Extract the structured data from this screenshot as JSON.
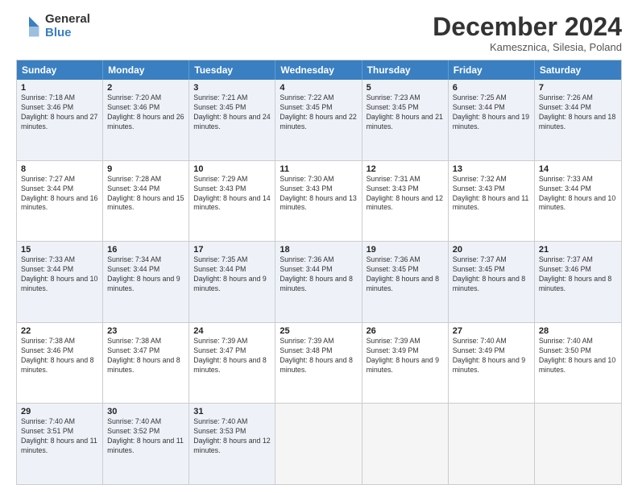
{
  "logo": {
    "general": "General",
    "blue": "Blue"
  },
  "header": {
    "month": "December 2024",
    "location": "Kamesznica, Silesia, Poland"
  },
  "days": [
    "Sunday",
    "Monday",
    "Tuesday",
    "Wednesday",
    "Thursday",
    "Friday",
    "Saturday"
  ],
  "rows": [
    [
      {
        "day": "1",
        "rise": "Sunrise: 7:18 AM",
        "set": "Sunset: 3:46 PM",
        "light": "Daylight: 8 hours and 27 minutes."
      },
      {
        "day": "2",
        "rise": "Sunrise: 7:20 AM",
        "set": "Sunset: 3:46 PM",
        "light": "Daylight: 8 hours and 26 minutes."
      },
      {
        "day": "3",
        "rise": "Sunrise: 7:21 AM",
        "set": "Sunset: 3:45 PM",
        "light": "Daylight: 8 hours and 24 minutes."
      },
      {
        "day": "4",
        "rise": "Sunrise: 7:22 AM",
        "set": "Sunset: 3:45 PM",
        "light": "Daylight: 8 hours and 22 minutes."
      },
      {
        "day": "5",
        "rise": "Sunrise: 7:23 AM",
        "set": "Sunset: 3:45 PM",
        "light": "Daylight: 8 hours and 21 minutes."
      },
      {
        "day": "6",
        "rise": "Sunrise: 7:25 AM",
        "set": "Sunset: 3:44 PM",
        "light": "Daylight: 8 hours and 19 minutes."
      },
      {
        "day": "7",
        "rise": "Sunrise: 7:26 AM",
        "set": "Sunset: 3:44 PM",
        "light": "Daylight: 8 hours and 18 minutes."
      }
    ],
    [
      {
        "day": "8",
        "rise": "Sunrise: 7:27 AM",
        "set": "Sunset: 3:44 PM",
        "light": "Daylight: 8 hours and 16 minutes."
      },
      {
        "day": "9",
        "rise": "Sunrise: 7:28 AM",
        "set": "Sunset: 3:44 PM",
        "light": "Daylight: 8 hours and 15 minutes."
      },
      {
        "day": "10",
        "rise": "Sunrise: 7:29 AM",
        "set": "Sunset: 3:43 PM",
        "light": "Daylight: 8 hours and 14 minutes."
      },
      {
        "day": "11",
        "rise": "Sunrise: 7:30 AM",
        "set": "Sunset: 3:43 PM",
        "light": "Daylight: 8 hours and 13 minutes."
      },
      {
        "day": "12",
        "rise": "Sunrise: 7:31 AM",
        "set": "Sunset: 3:43 PM",
        "light": "Daylight: 8 hours and 12 minutes."
      },
      {
        "day": "13",
        "rise": "Sunrise: 7:32 AM",
        "set": "Sunset: 3:43 PM",
        "light": "Daylight: 8 hours and 11 minutes."
      },
      {
        "day": "14",
        "rise": "Sunrise: 7:33 AM",
        "set": "Sunset: 3:44 PM",
        "light": "Daylight: 8 hours and 10 minutes."
      }
    ],
    [
      {
        "day": "15",
        "rise": "Sunrise: 7:33 AM",
        "set": "Sunset: 3:44 PM",
        "light": "Daylight: 8 hours and 10 minutes."
      },
      {
        "day": "16",
        "rise": "Sunrise: 7:34 AM",
        "set": "Sunset: 3:44 PM",
        "light": "Daylight: 8 hours and 9 minutes."
      },
      {
        "day": "17",
        "rise": "Sunrise: 7:35 AM",
        "set": "Sunset: 3:44 PM",
        "light": "Daylight: 8 hours and 9 minutes."
      },
      {
        "day": "18",
        "rise": "Sunrise: 7:36 AM",
        "set": "Sunset: 3:44 PM",
        "light": "Daylight: 8 hours and 8 minutes."
      },
      {
        "day": "19",
        "rise": "Sunrise: 7:36 AM",
        "set": "Sunset: 3:45 PM",
        "light": "Daylight: 8 hours and 8 minutes."
      },
      {
        "day": "20",
        "rise": "Sunrise: 7:37 AM",
        "set": "Sunset: 3:45 PM",
        "light": "Daylight: 8 hours and 8 minutes."
      },
      {
        "day": "21",
        "rise": "Sunrise: 7:37 AM",
        "set": "Sunset: 3:46 PM",
        "light": "Daylight: 8 hours and 8 minutes."
      }
    ],
    [
      {
        "day": "22",
        "rise": "Sunrise: 7:38 AM",
        "set": "Sunset: 3:46 PM",
        "light": "Daylight: 8 hours and 8 minutes."
      },
      {
        "day": "23",
        "rise": "Sunrise: 7:38 AM",
        "set": "Sunset: 3:47 PM",
        "light": "Daylight: 8 hours and 8 minutes."
      },
      {
        "day": "24",
        "rise": "Sunrise: 7:39 AM",
        "set": "Sunset: 3:47 PM",
        "light": "Daylight: 8 hours and 8 minutes."
      },
      {
        "day": "25",
        "rise": "Sunrise: 7:39 AM",
        "set": "Sunset: 3:48 PM",
        "light": "Daylight: 8 hours and 8 minutes."
      },
      {
        "day": "26",
        "rise": "Sunrise: 7:39 AM",
        "set": "Sunset: 3:49 PM",
        "light": "Daylight: 8 hours and 9 minutes."
      },
      {
        "day": "27",
        "rise": "Sunrise: 7:40 AM",
        "set": "Sunset: 3:49 PM",
        "light": "Daylight: 8 hours and 9 minutes."
      },
      {
        "day": "28",
        "rise": "Sunrise: 7:40 AM",
        "set": "Sunset: 3:50 PM",
        "light": "Daylight: 8 hours and 10 minutes."
      }
    ],
    [
      {
        "day": "29",
        "rise": "Sunrise: 7:40 AM",
        "set": "Sunset: 3:51 PM",
        "light": "Daylight: 8 hours and 11 minutes."
      },
      {
        "day": "30",
        "rise": "Sunrise: 7:40 AM",
        "set": "Sunset: 3:52 PM",
        "light": "Daylight: 8 hours and 11 minutes."
      },
      {
        "day": "31",
        "rise": "Sunrise: 7:40 AM",
        "set": "Sunset: 3:53 PM",
        "light": "Daylight: 8 hours and 12 minutes."
      },
      null,
      null,
      null,
      null
    ]
  ],
  "alt_rows": [
    0,
    2,
    4
  ],
  "colors": {
    "header_bg": "#3a7fc1",
    "alt_row": "#eef2f8",
    "normal_row": "#ffffff",
    "empty": "#f5f5f5"
  }
}
